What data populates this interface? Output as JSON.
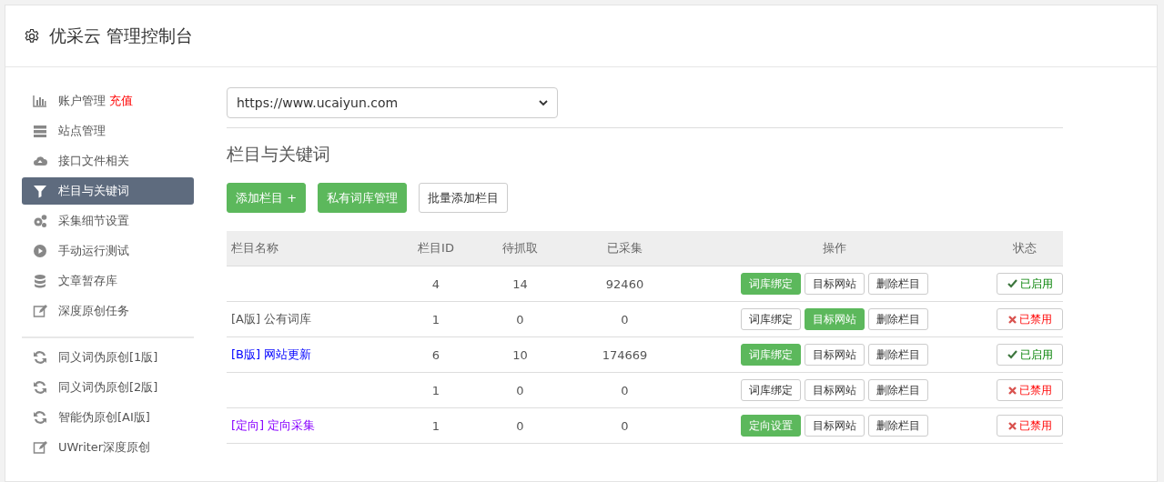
{
  "header": {
    "title": "优采云 管理控制台"
  },
  "sidebar": {
    "items": [
      {
        "kind": "chart",
        "label": "账户管理",
        "badge": "充值",
        "selected": false
      },
      {
        "kind": "server",
        "label": "站点管理",
        "selected": false
      },
      {
        "kind": "cloud",
        "label": "接口文件相关",
        "selected": false
      },
      {
        "kind": "filter",
        "label": "栏目与关键词",
        "selected": true
      },
      {
        "kind": "gears",
        "label": "采集细节设置",
        "selected": false
      },
      {
        "kind": "play",
        "label": "手动运行测试",
        "selected": false
      },
      {
        "kind": "database",
        "label": "文章暂存库",
        "selected": false
      },
      {
        "kind": "edit",
        "label": "深度原创任务",
        "selected": false
      }
    ],
    "tools": [
      {
        "kind": "refresh",
        "label": "同义词伪原创[1版]"
      },
      {
        "kind": "refresh",
        "label": "同义词伪原创[2版]"
      },
      {
        "kind": "refresh",
        "label": "智能伪原创[AI版]"
      },
      {
        "kind": "edit",
        "label": "UWriter深度原创"
      }
    ]
  },
  "site_select": {
    "value": "https://www.ucaiyun.com"
  },
  "section_title": "栏目与关键词",
  "toolbar": [
    {
      "label": "添加栏目 +",
      "kind": "primary"
    },
    {
      "label": "私有词库管理",
      "kind": "primary"
    },
    {
      "label": "批量添加栏目",
      "kind": "default"
    }
  ],
  "table": {
    "columns": [
      "栏目名称",
      "栏目ID",
      "待抓取",
      "已采集",
      "操作",
      "状态"
    ],
    "rows": [
      {
        "id": "4",
        "pending": "14",
        "collected": "92460",
        "actions": [
          {
            "label": "词库绑定",
            "selected": true
          },
          {
            "label": "目标网站",
            "selected": false
          },
          {
            "label": "删除栏目",
            "selected": false
          }
        ],
        "status": "已启用",
        "enabled": true
      },
      {
        "name": "[A版] 公有词库",
        "color": "#555555",
        "id": "1",
        "pending": "0",
        "collected": "0",
        "actions": [
          {
            "label": "词库绑定",
            "selected": false
          },
          {
            "label": "目标网站",
            "selected": true
          },
          {
            "label": "删除栏目",
            "selected": false
          }
        ],
        "status": "已禁用",
        "enabled": false
      },
      {
        "name": "[B版] 网站更新",
        "color": "#0000ff",
        "id": "6",
        "pending": "10",
        "collected": "174669",
        "actions": [
          {
            "label": "词库绑定",
            "selected": true
          },
          {
            "label": "目标网站",
            "selected": false
          },
          {
            "label": "删除栏目",
            "selected": false
          }
        ],
        "status": "已启用",
        "enabled": true
      },
      {
        "id": "1",
        "pending": "0",
        "collected": "0",
        "actions": [
          {
            "label": "词库绑定",
            "selected": false
          },
          {
            "label": "目标网站",
            "selected": false
          },
          {
            "label": "删除栏目",
            "selected": false
          }
        ],
        "status": "已禁用",
        "enabled": false
      },
      {
        "name": "[定向] 定向采集",
        "color": "#8800ff",
        "id": "1",
        "pending": "0",
        "collected": "0",
        "actions": [
          {
            "label": "定向设置",
            "selected": true
          },
          {
            "label": "目标网站",
            "selected": false
          },
          {
            "label": "删除栏目",
            "selected": false
          }
        ],
        "status": "已禁用",
        "enabled": false
      }
    ]
  }
}
